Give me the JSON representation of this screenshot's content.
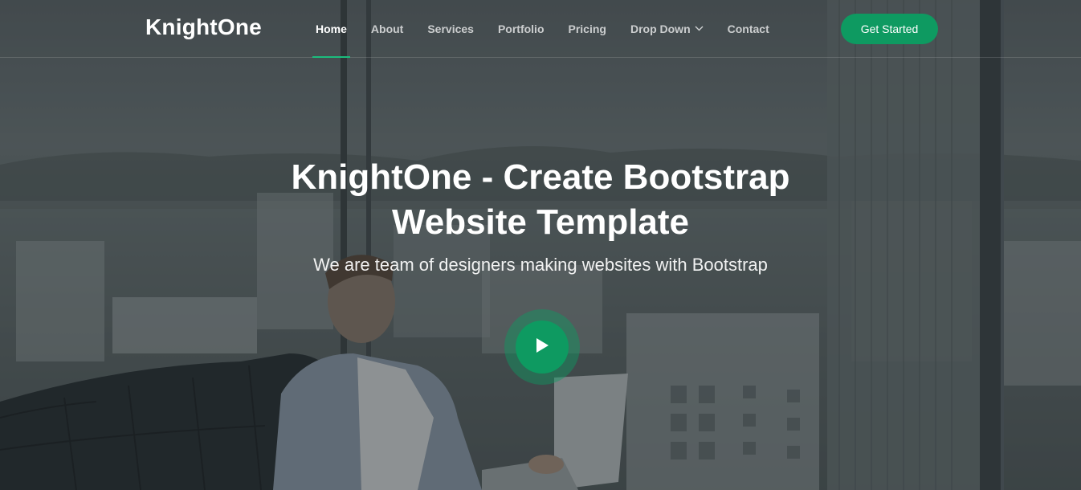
{
  "brand": {
    "name": "KnightOne"
  },
  "nav": {
    "items": [
      {
        "label": "Home"
      },
      {
        "label": "About"
      },
      {
        "label": "Services"
      },
      {
        "label": "Portfolio"
      },
      {
        "label": "Pricing"
      },
      {
        "label": "Drop Down"
      },
      {
        "label": "Contact"
      }
    ],
    "active": "Home",
    "dropdown_icon": "chevron-down-icon"
  },
  "header": {
    "cta_label": "Get Started"
  },
  "hero": {
    "title_line1": "KnightOne - Create Bootstrap",
    "title_line2": "Website Template",
    "subtitle": "We are team of designers making websites with Bootstrap",
    "play_icon": "play-icon"
  },
  "colors": {
    "accent": "#0e9a61",
    "active_underline": "#1bbd7d"
  }
}
